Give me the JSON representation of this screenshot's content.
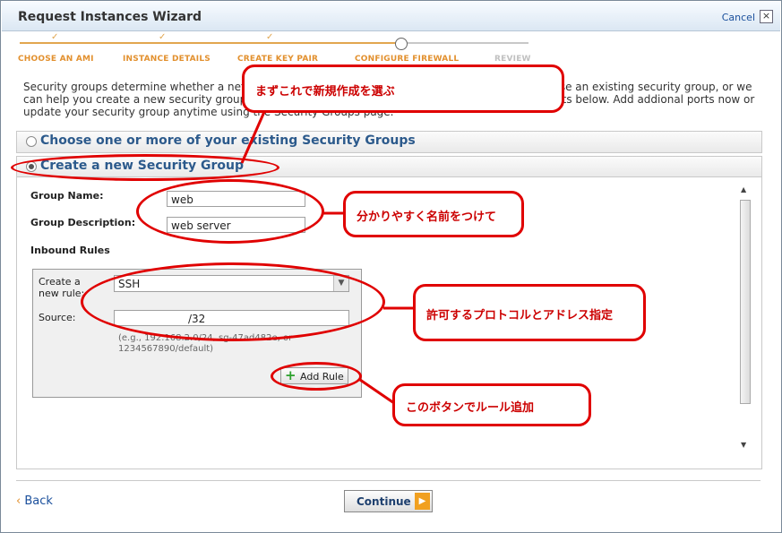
{
  "window": {
    "title": "Request Instances Wizard",
    "cancel_label": "Cancel",
    "close_glyph": "×"
  },
  "steps": [
    {
      "label": "CHOOSE AN AMI",
      "state": "done"
    },
    {
      "label": "INSTANCE DETAILS",
      "state": "done"
    },
    {
      "label": "CREATE KEY PAIR",
      "state": "done"
    },
    {
      "label": "CONFIGURE FIREWALL",
      "state": "current"
    },
    {
      "label": "REVIEW",
      "state": "pending"
    }
  ],
  "intro_text": "Security groups determine whether a network port is open or blocked on your instances. You may use an existing security group, or we can help you create a new security group to allow access to your instances using the suggested ports below. Add addional ports now or update your security group anytime using the Security Groups page.",
  "radio": {
    "existing_label": "Choose one or more of your existing Security Groups",
    "new_label": "Create a new Security Group"
  },
  "form": {
    "group_name_label": "Group Name:",
    "group_name_value": "web",
    "group_desc_label": "Group Description:",
    "group_desc_value": "web server",
    "inbound_label": "Inbound Rules"
  },
  "rule": {
    "create_label": "Create a new rule:",
    "rule_value": "SSH",
    "source_label": "Source:",
    "source_value": "/32",
    "hint": "(e.g., 192.168.2.0/24, sg-47ad482e, or 1234567890/default)",
    "add_rule_label": "Add Rule"
  },
  "footer": {
    "back_label": "Back",
    "back_glyph": "‹",
    "continue_label": "Continue"
  },
  "annotations": {
    "select_new": "まずこれで新規作成を選ぶ",
    "name_it": "分かりやすく名前をつけて",
    "protocol": "許可するプロトコルとアドレス指定",
    "add_button": "このボタンでルール追加"
  },
  "colors": {
    "annotation": "#e00000",
    "step_done": "#e2902e",
    "link": "#1a4f9c"
  }
}
